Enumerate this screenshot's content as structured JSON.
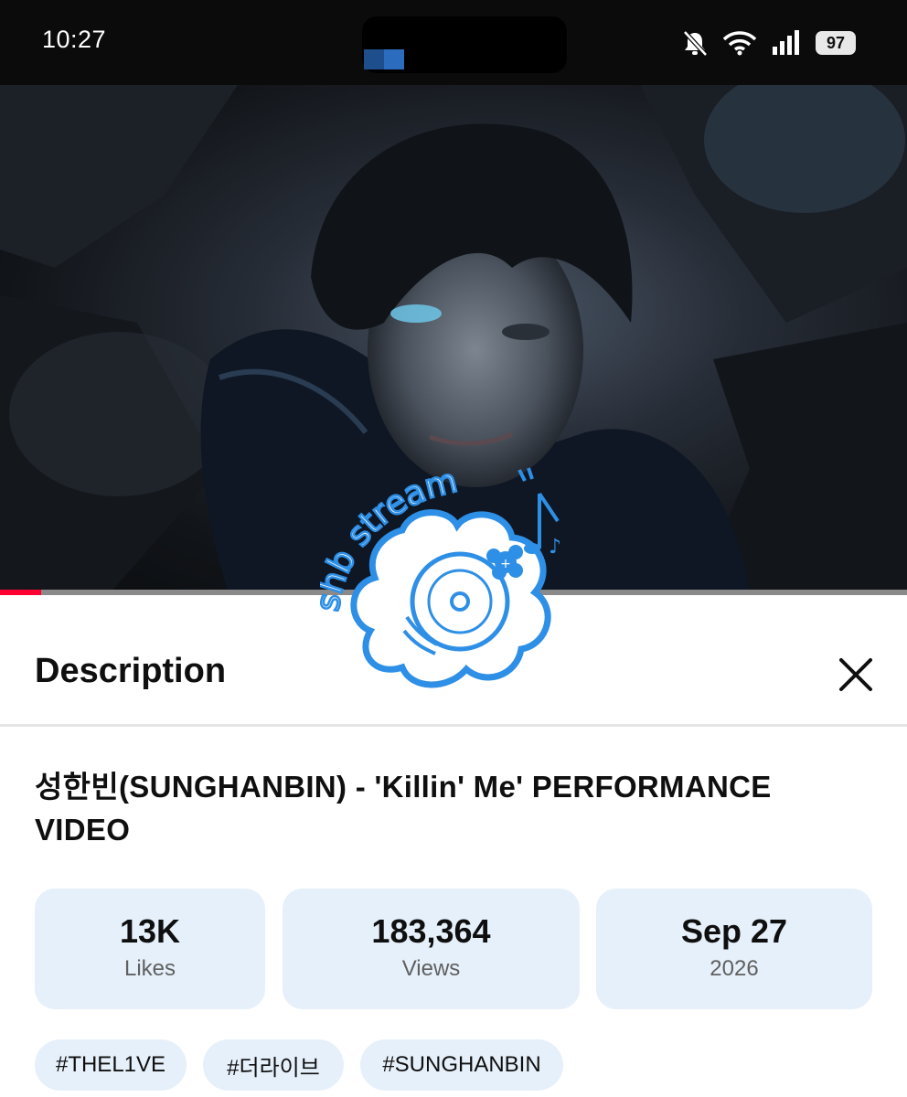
{
  "status_bar": {
    "time": "10:27",
    "battery": "97",
    "icons": [
      "bell-off-icon",
      "wifi-icon",
      "signal-icon",
      "battery-icon"
    ]
  },
  "video": {
    "progress_fraction": 0.045,
    "accent_color": "#ff0033"
  },
  "sticker": {
    "text": "shb stream"
  },
  "description_panel": {
    "header": "Description",
    "close_icon": "close-icon",
    "title": "성한빈(SUNGHANBIN) - 'Killin' Me' PERFORMANCE VIDEO",
    "stats": [
      {
        "value": "13K",
        "label": "Likes"
      },
      {
        "value": "183,364",
        "label": "Views"
      },
      {
        "value": "Sep 27",
        "label": "2026"
      }
    ],
    "hashtags": [
      "#THEL1VE",
      "#더라이브",
      "#SUNGHANBIN"
    ]
  },
  "colors": {
    "chip_background": "#e6f0fa",
    "sticker_blue": "#2e8fe6"
  }
}
